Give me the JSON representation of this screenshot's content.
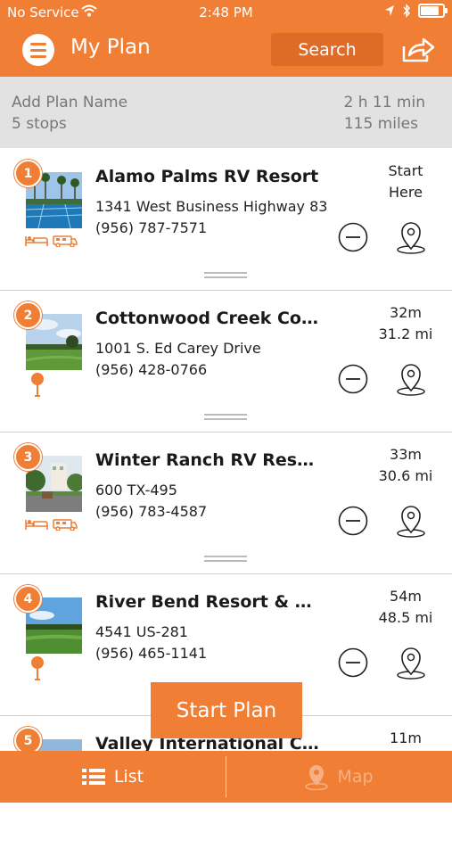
{
  "status_bar": {
    "carrier": "No Service",
    "time": "2:48 PM"
  },
  "header": {
    "title": "My Plan",
    "search_label": "Search"
  },
  "plan": {
    "name_placeholder": "Add Plan Name",
    "stops_count": "5 stops",
    "total_time": "2 h 11 min",
    "total_distance": "115 miles"
  },
  "stops": [
    {
      "number": "1",
      "name": "Alamo Palms RV Resort",
      "address": "1341 West Business Highway 83",
      "phone": "(956) 787-7571",
      "info_line1": "Start",
      "info_line2": "Here",
      "amenities": "lodging-rv"
    },
    {
      "number": "2",
      "name": "Cottonwood Creek Coun…",
      "address": "1001 S. Ed Carey Drive",
      "phone": "(956) 428-0766",
      "info_line1": "32m",
      "info_line2": "31.2 mi",
      "amenities": "golf"
    },
    {
      "number": "3",
      "name": "Winter Ranch RV Resort",
      "address": "600 TX-495",
      "phone": "(956) 783-4587",
      "info_line1": "33m",
      "info_line2": "30.6 mi",
      "amenities": "lodging-rv"
    },
    {
      "number": "4",
      "name": "River Bend Resort & Golf…",
      "address": "4541 US-281",
      "phone": "(956) 465-1141",
      "info_line1": "54m",
      "info_line2": "48.5 mi",
      "amenities": "golf"
    },
    {
      "number": "5",
      "name": "Valley International Cou…",
      "address": "",
      "phone": "",
      "info_line1": "11m",
      "info_line2": "",
      "amenities": ""
    }
  ],
  "start_plan_label": "Start Plan",
  "tabs": {
    "list_label": "List",
    "map_label": "Map"
  },
  "colors": {
    "accent": "#f07f35",
    "summary_bg": "#e2e2e2",
    "inactive_tab": "#f7b084"
  }
}
